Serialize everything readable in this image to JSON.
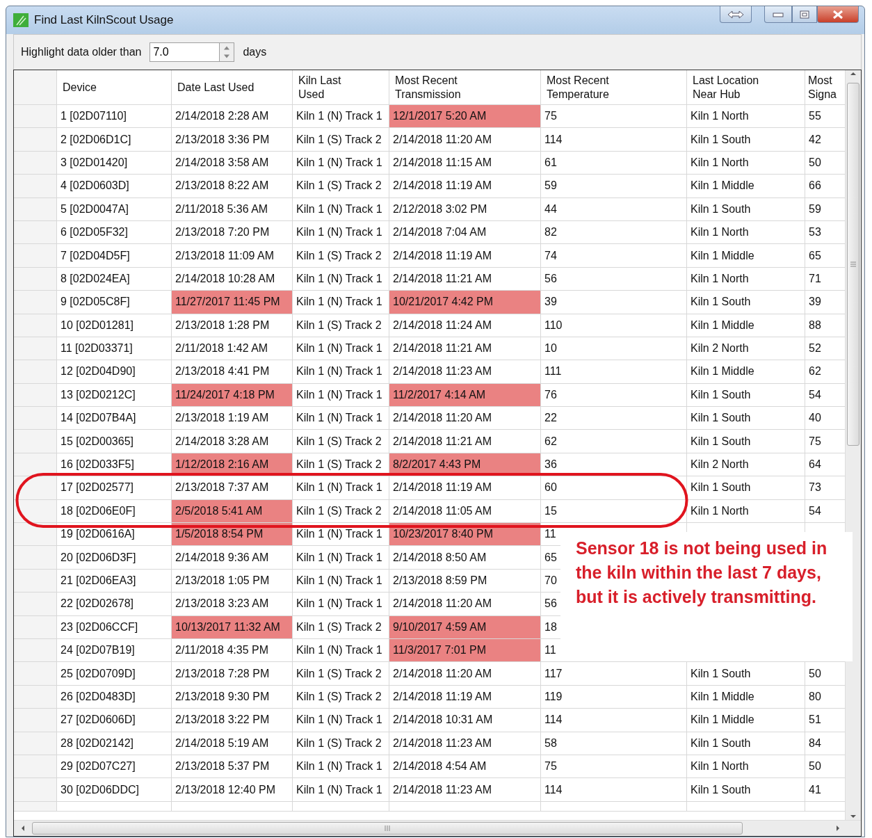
{
  "window": {
    "title": "Find Last KilnScout Usage"
  },
  "filter": {
    "label": "Highlight data older than",
    "value": "7.0",
    "unit": "days"
  },
  "table": {
    "columns": [
      "Device",
      "Date Last Used",
      "Kiln Last\nUsed",
      "Most Recent\nTransmission",
      "Most Recent\nTemperature",
      "Last Location\nNear Hub",
      "Most\nSigna"
    ],
    "rows": [
      {
        "device": "1 [02D07110]",
        "date": "2/14/2018 2:28 AM",
        "date_old": false,
        "kiln": "Kiln 1 (N) Track 1",
        "transmission": "12/1/2017 5:20 AM",
        "transmission_old": true,
        "temperature": "75",
        "location": "Kiln 1 North",
        "signal": "55"
      },
      {
        "device": "2 [02D06D1C]",
        "date": "2/13/2018 3:36 PM",
        "date_old": false,
        "kiln": "Kiln 1 (S) Track 2",
        "transmission": "2/14/2018 11:20 AM",
        "transmission_old": false,
        "temperature": "114",
        "location": "Kiln 1 South",
        "signal": "42"
      },
      {
        "device": "3 [02D01420]",
        "date": "2/14/2018 3:58 AM",
        "date_old": false,
        "kiln": "Kiln 1 (N) Track 1",
        "transmission": "2/14/2018 11:15 AM",
        "transmission_old": false,
        "temperature": "61",
        "location": "Kiln 1 North",
        "signal": "50"
      },
      {
        "device": "4 [02D0603D]",
        "date": "2/13/2018 8:22 AM",
        "date_old": false,
        "kiln": "Kiln 1 (S) Track 2",
        "transmission": "2/14/2018 11:19 AM",
        "transmission_old": false,
        "temperature": "59",
        "location": "Kiln 1 Middle",
        "signal": "66"
      },
      {
        "device": "5 [02D0047A]",
        "date": "2/11/2018 5:36 AM",
        "date_old": false,
        "kiln": "Kiln 1 (N) Track 1",
        "transmission": "2/12/2018 3:02 PM",
        "transmission_old": false,
        "temperature": "44",
        "location": "Kiln 1 South",
        "signal": "59"
      },
      {
        "device": "6 [02D05F32]",
        "date": "2/13/2018 7:20 PM",
        "date_old": false,
        "kiln": "Kiln 1 (N) Track 1",
        "transmission": "2/14/2018 7:04 AM",
        "transmission_old": false,
        "temperature": "82",
        "location": "Kiln 1 North",
        "signal": "53"
      },
      {
        "device": "7 [02D04D5F]",
        "date": "2/13/2018 11:09 AM",
        "date_old": false,
        "kiln": "Kiln 1 (S) Track 2",
        "transmission": "2/14/2018 11:19 AM",
        "transmission_old": false,
        "temperature": "74",
        "location": "Kiln 1 Middle",
        "signal": "65"
      },
      {
        "device": "8 [02D024EA]",
        "date": "2/14/2018 10:28 AM",
        "date_old": false,
        "kiln": "Kiln 1 (N) Track 1",
        "transmission": "2/14/2018 11:21 AM",
        "transmission_old": false,
        "temperature": "56",
        "location": "Kiln 1 North",
        "signal": "71"
      },
      {
        "device": "9 [02D05C8F]",
        "date": "11/27/2017 11:45 PM",
        "date_old": true,
        "kiln": "Kiln 1 (N) Track 1",
        "transmission": "10/21/2017 4:42 PM",
        "transmission_old": true,
        "temperature": "39",
        "location": "Kiln 1 South",
        "signal": "39"
      },
      {
        "device": "10 [02D01281]",
        "date": "2/13/2018 1:28 PM",
        "date_old": false,
        "kiln": "Kiln 1 (S) Track 2",
        "transmission": "2/14/2018 11:24 AM",
        "transmission_old": false,
        "temperature": "110",
        "location": "Kiln 1 Middle",
        "signal": "88"
      },
      {
        "device": "11 [02D03371]",
        "date": "2/11/2018 1:42 AM",
        "date_old": false,
        "kiln": "Kiln 1 (N) Track 1",
        "transmission": "2/14/2018 11:21 AM",
        "transmission_old": false,
        "temperature": "10",
        "location": "Kiln 2 North",
        "signal": "52"
      },
      {
        "device": "12 [02D04D90]",
        "date": "2/13/2018 4:41 PM",
        "date_old": false,
        "kiln": "Kiln 1 (N) Track 1",
        "transmission": "2/14/2018 11:23 AM",
        "transmission_old": false,
        "temperature": "111",
        "location": "Kiln 1 Middle",
        "signal": "62"
      },
      {
        "device": "13 [02D0212C]",
        "date": "11/24/2017 4:18 PM",
        "date_old": true,
        "kiln": "Kiln 1 (N) Track 1",
        "transmission": "11/2/2017 4:14 AM",
        "transmission_old": true,
        "temperature": "76",
        "location": "Kiln 1 South",
        "signal": "54"
      },
      {
        "device": "14 [02D07B4A]",
        "date": "2/13/2018 1:19 AM",
        "date_old": false,
        "kiln": "Kiln 1 (N) Track 1",
        "transmission": "2/14/2018 11:20 AM",
        "transmission_old": false,
        "temperature": "22",
        "location": "Kiln 1 South",
        "signal": "40"
      },
      {
        "device": "15 [02D00365]",
        "date": "2/14/2018 3:28 AM",
        "date_old": false,
        "kiln": "Kiln 1 (S) Track 2",
        "transmission": "2/14/2018 11:21 AM",
        "transmission_old": false,
        "temperature": "62",
        "location": "Kiln 1 South",
        "signal": "75"
      },
      {
        "device": "16 [02D033F5]",
        "date": "1/12/2018 2:16 AM",
        "date_old": true,
        "kiln": "Kiln 1 (S) Track 2",
        "transmission": "8/2/2017 4:43 PM",
        "transmission_old": true,
        "temperature": "36",
        "location": "Kiln 2 North",
        "signal": "64"
      },
      {
        "device": "17 [02D02577]",
        "date": "2/13/2018 7:37 AM",
        "date_old": false,
        "kiln": "Kiln 1 (N) Track 1",
        "transmission": "2/14/2018 11:19 AM",
        "transmission_old": false,
        "temperature": "60",
        "location": "Kiln 1 South",
        "signal": "73"
      },
      {
        "device": "18 [02D06E0F]",
        "date": "2/5/2018 5:41 AM",
        "date_old": true,
        "kiln": "Kiln 1 (S) Track 2",
        "transmission": "2/14/2018 11:05 AM",
        "transmission_old": false,
        "temperature": "15",
        "location": "Kiln 1 North",
        "signal": "54"
      },
      {
        "device": "19 [02D0616A]",
        "date": "1/5/2018 8:54 PM",
        "date_old": true,
        "kiln": "Kiln 1 (N) Track 1",
        "transmission": "10/23/2017 8:40 PM",
        "transmission_old": true,
        "temperature": "11"
      },
      {
        "device": "20 [02D06D3F]",
        "date": "2/14/2018 9:36 AM",
        "date_old": false,
        "kiln": "Kiln 1 (N) Track 1",
        "transmission": "2/14/2018 8:50 AM",
        "transmission_old": false,
        "temperature": "65"
      },
      {
        "device": "21 [02D06EA3]",
        "date": "2/13/2018 1:05 PM",
        "date_old": false,
        "kiln": "Kiln 1 (N) Track 1",
        "transmission": "2/13/2018 8:59 PM",
        "transmission_old": false,
        "temperature": "70"
      },
      {
        "device": "22 [02D02678]",
        "date": "2/13/2018 3:23 AM",
        "date_old": false,
        "kiln": "Kiln 1 (N) Track 1",
        "transmission": "2/14/2018 11:20 AM",
        "transmission_old": false,
        "temperature": "56"
      },
      {
        "device": "23 [02D06CCF]",
        "date": "10/13/2017 11:32 AM",
        "date_old": true,
        "kiln": "Kiln 1 (S) Track 2",
        "transmission": "9/10/2017 4:59 AM",
        "transmission_old": true,
        "temperature": "18"
      },
      {
        "device": "24 [02D07B19]",
        "date": "2/11/2018 4:35 PM",
        "date_old": false,
        "kiln": "Kiln 1 (N) Track 1",
        "transmission": "11/3/2017 7:01 PM",
        "transmission_old": true,
        "temperature": "11"
      },
      {
        "device": "25 [02D0709D]",
        "date": "2/13/2018 7:28 PM",
        "date_old": false,
        "kiln": "Kiln 1 (S) Track 2",
        "transmission": "2/14/2018 11:20 AM",
        "transmission_old": false,
        "temperature": "117",
        "location": "Kiln 1 South",
        "signal": "50"
      },
      {
        "device": "26 [02D0483D]",
        "date": "2/13/2018 9:30 PM",
        "date_old": false,
        "kiln": "Kiln 1 (S) Track 2",
        "transmission": "2/14/2018 11:19 AM",
        "transmission_old": false,
        "temperature": "119",
        "location": "Kiln 1 Middle",
        "signal": "80"
      },
      {
        "device": "27 [02D0606D]",
        "date": "2/13/2018 3:22 PM",
        "date_old": false,
        "kiln": "Kiln 1 (N) Track 1",
        "transmission": "2/14/2018 10:31 AM",
        "transmission_old": false,
        "temperature": "114",
        "location": "Kiln 1 Middle",
        "signal": "51"
      },
      {
        "device": "28 [02D02142]",
        "date": "2/14/2018 5:19 AM",
        "date_old": false,
        "kiln": "Kiln 1 (S) Track 2",
        "transmission": "2/14/2018 11:23 AM",
        "transmission_old": false,
        "temperature": "58",
        "location": "Kiln 1 South",
        "signal": "84"
      },
      {
        "device": "29 [02D07C27]",
        "date": "2/13/2018 5:37 PM",
        "date_old": false,
        "kiln": "Kiln 1 (N) Track 1",
        "transmission": "2/14/2018 4:54 AM",
        "transmission_old": false,
        "temperature": "75",
        "location": "Kiln 1 North",
        "signal": "50"
      },
      {
        "device": "30 [02D06DDC]",
        "date": "2/13/2018 12:40 PM",
        "date_old": false,
        "kiln": "Kiln 1 (N) Track 1",
        "transmission": "2/14/2018 11:23 AM",
        "transmission_old": false,
        "temperature": "114",
        "location": "Kiln 1 South",
        "signal": "41"
      }
    ]
  },
  "annotation": {
    "text": "Sensor 18 is not being used in the kiln within the last 7 days, but it is actively transmitting."
  }
}
